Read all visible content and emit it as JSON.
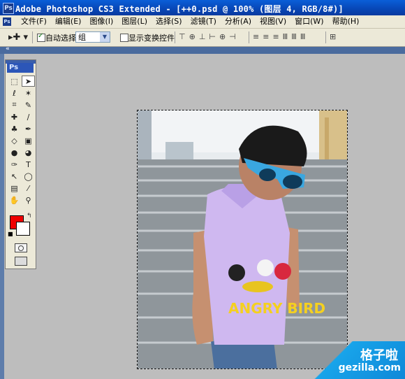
{
  "window": {
    "title": "Adobe Photoshop CS3 Extended - [++0.psd @ 100% (图层 4, RGB/8#)]",
    "app_icon": "ps-icon"
  },
  "menubar": {
    "items": [
      {
        "label": "文件(F)"
      },
      {
        "label": "编辑(E)"
      },
      {
        "label": "图像(I)"
      },
      {
        "label": "图层(L)"
      },
      {
        "label": "选择(S)"
      },
      {
        "label": "滤镜(T)"
      },
      {
        "label": "分析(A)"
      },
      {
        "label": "视图(V)"
      },
      {
        "label": "窗口(W)"
      },
      {
        "label": "帮助(H)"
      }
    ]
  },
  "options_bar": {
    "tool_icon": "move-tool-icon",
    "auto_select_label": "自动选择:",
    "auto_select_checked": true,
    "auto_select_value": "组",
    "show_transform_label": "显示变换控件",
    "show_transform_checked": false
  },
  "toolbox": {
    "ps_label": "Ps",
    "foreground_color": "#f00000",
    "background_color": "#ffffff"
  },
  "watermark": {
    "brand": "格子啦",
    "url": "gezilla.com"
  }
}
